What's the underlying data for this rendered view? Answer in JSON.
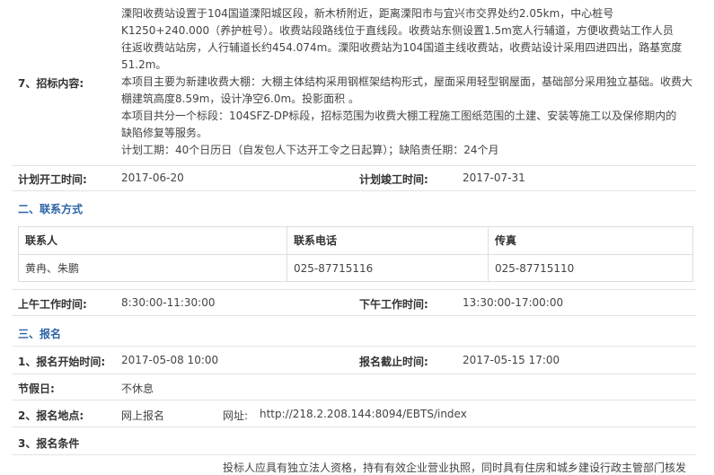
{
  "bid_content": {
    "label": "7、招标内容:",
    "lines": [
      "溧阳收费站设置于104国道溧阳城区段，新木桥附近，距离溧阳市与宜兴市交界处约2.05km，中心桩号",
      "K1250+240.000（养护桩号）。收费站段路线位于直线段。收费站东侧设置1.5m宽人行辅道，方便收费站工作人员",
      "往返收费站站房，人行辅道长约454.074m。溧阳收费站为104国道主线收费站，收费站设计采用四进四出，路基宽度",
      "51.2m。",
      "本项目主要为新建收费大棚：大棚主体结构采用钢框架结构形式，屋面采用轻型钢屋面，基础部分采用独立基础。收费大",
      "棚建筑高度8.59m，设计净空6.0m。投影面积 。",
      "本项目共分一个标段：104SFZ-DP标段，招标范围为收费大棚工程施工图纸范围的土建、安装等施工以及保修期内的",
      "缺陷修复等服务。",
      "计划工期：40个日历日（自发包人下达开工令之日起算）；缺陷责任期：24个月"
    ]
  },
  "schedule": {
    "start_label": "计划开工时间:",
    "start_value": "2017-06-20",
    "end_label": "计划竣工时间:",
    "end_value": "2017-07-31"
  },
  "contact": {
    "section_title": "二、联系方式",
    "headers": [
      "联系人",
      "联系电话",
      "传真"
    ],
    "row": [
      "黄冉、朱鹏",
      "025-87715116",
      "025-87715110"
    ]
  },
  "work_hours": {
    "am_label": "上午工作时间:",
    "am_value": "8:30:00-11:30:00",
    "pm_label": "下午工作时间:",
    "pm_value": "13:30:00-17:00:00"
  },
  "registration": {
    "section_title": "三、报名",
    "start_label": "1、报名开始时间:",
    "start_value": "2017-05-08 10:00",
    "end_label": "报名截止时间:",
    "end_value": "2017-05-15 17:00",
    "holiday_label": "节假日:",
    "holiday_value": "不休息",
    "place_label": "2、报名地点:",
    "place_value": "网上报名",
    "url_label": "网址:",
    "url_value": "http://218.2.208.144:8094/EBTS/index",
    "cond_label": "3、报名条件",
    "cond_first_line": "投标人应具有独立法人资格，持有有效企业营业执照，同时具有住房和城乡建设行政主管部门核发"
  }
}
